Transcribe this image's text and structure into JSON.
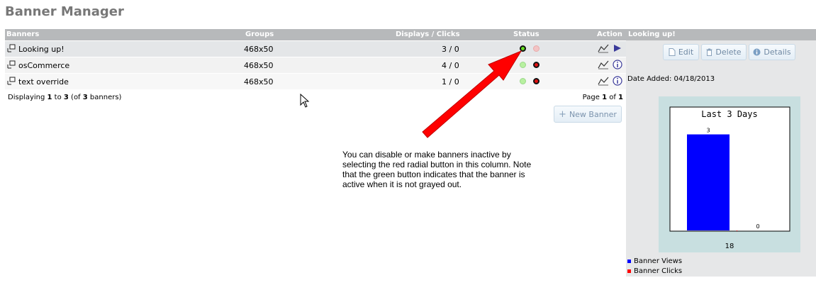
{
  "page": {
    "title": "Banner Manager"
  },
  "table": {
    "columns": {
      "banners": "Banners",
      "groups": "Groups",
      "displays_clicks": "Displays / Clicks",
      "status": "Status",
      "action": "Action"
    },
    "rows": [
      {
        "name": "Looking up!",
        "group": "468x50",
        "displays_clicks": "3 / 0",
        "status": "active",
        "selected": true
      },
      {
        "name": "osCommerce",
        "group": "468x50",
        "displays_clicks": "4 / 0",
        "status": "inactive",
        "selected": false
      },
      {
        "name": "text override",
        "group": "468x50",
        "displays_clicks": "1 / 0",
        "status": "inactive",
        "selected": false
      }
    ],
    "footer": {
      "displaying_prefix": "Displaying ",
      "from": "1",
      "to_word": " to ",
      "to": "3",
      "of_prefix": " (of ",
      "total": "3",
      "of_suffix": " banners)",
      "page_prefix": "Page ",
      "page_current": "1",
      "page_of": " of ",
      "page_total": "1"
    },
    "new_banner_label": "New Banner"
  },
  "panel": {
    "header": "Looking up!",
    "buttons": {
      "edit": "Edit",
      "delete": "Delete",
      "details": "Details"
    },
    "date_added": "Date Added: 04/18/2013",
    "legend": {
      "views": "Banner Views",
      "clicks": "Banner Clicks"
    }
  },
  "chart_data": {
    "type": "bar",
    "title": "Last 3 Days",
    "categories": [
      "18"
    ],
    "series": [
      {
        "name": "Banner Views",
        "values": [
          3
        ],
        "color": "#0000ff"
      },
      {
        "name": "Banner Clicks",
        "values": [
          0
        ],
        "color": "#ff0000"
      }
    ],
    "data_labels": [
      "3",
      "0"
    ],
    "ylim": [
      0,
      3.3
    ]
  },
  "annotation": {
    "text": "You can disable or make banners inactive by\nselecting the red radial button in this column.  Note\nthat the green button indicates that the banner is\nactive when it is not grayed out."
  },
  "colors": {
    "header_bg": "#b7b9bb",
    "arrow": "#ff0000",
    "status_active": "#66dd22",
    "status_inactive": "#e01010"
  }
}
